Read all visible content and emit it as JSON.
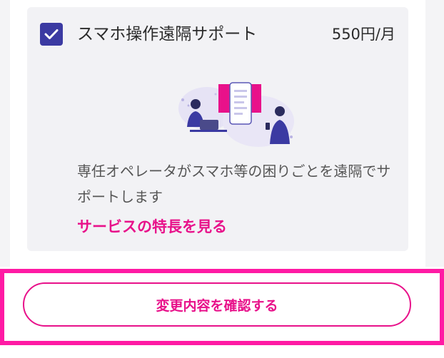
{
  "option": {
    "checked": true,
    "title": "スマホ操作遠隔サポート",
    "price": "550円/月",
    "illustration_icon": "remote-support-illustration",
    "description": "専任オペレータがスマホ等の困りごとを遠隔でサポートします",
    "feature_link": "サービスの特長を見る"
  },
  "footer": {
    "confirm_button": "変更内容を確認する"
  },
  "colors": {
    "accent": "#e8118a",
    "checkbox": "#3b3aa2",
    "highlight": "#ff1aa4",
    "card_bg": "#f2f2f5"
  }
}
